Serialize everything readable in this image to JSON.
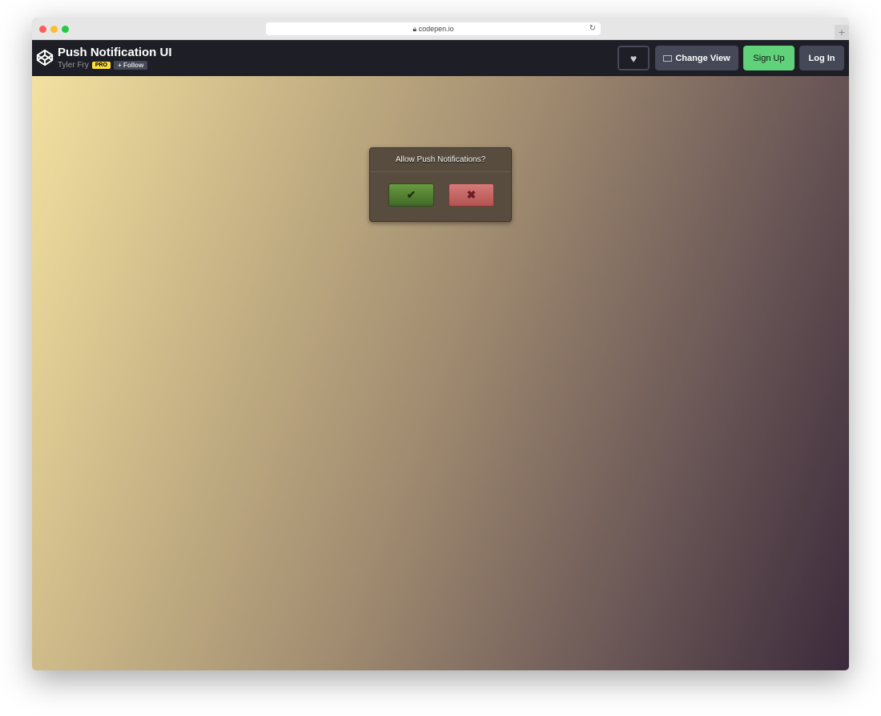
{
  "browser": {
    "url": "codepen.io"
  },
  "header": {
    "title": "Push Notification UI",
    "author": "Tyler Fry",
    "badge": "PRO",
    "follow_label": "+ Follow",
    "change_view_label": "Change View",
    "signup_label": "Sign Up",
    "login_label": "Log In"
  },
  "dialog": {
    "title": "Allow Push Notifications?",
    "accept_icon": "✔",
    "decline_icon": "✖"
  }
}
